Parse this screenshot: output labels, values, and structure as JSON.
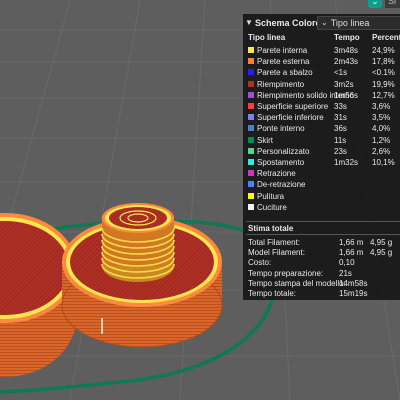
{
  "panel": {
    "title": "Schema Colore",
    "view_select": "Tipo linea",
    "columns": {
      "type": "Tipo linea",
      "time": "Tempo",
      "percent": "Percentuale"
    },
    "feature_rows": [
      {
        "name": "Parete interna",
        "time": "3m48s",
        "percent": "24,9%",
        "color": "#ffe64d"
      },
      {
        "name": "Parete esterna",
        "time": "2m43s",
        "percent": "17,8%",
        "color": "#ff7d38"
      },
      {
        "name": "Parete a sbalzo",
        "time": "<1s",
        "percent": "<0.1%",
        "color": "#1f1fff"
      },
      {
        "name": "Riempimento",
        "time": "3m2s",
        "percent": "19,9%",
        "color": "#b03029"
      },
      {
        "name": "Riempimento solido interno",
        "time": "1m56s",
        "percent": "12,7%",
        "color": "#9654cc"
      },
      {
        "name": "Superficie superiore",
        "time": "33s",
        "percent": "3,6%",
        "color": "#f04040"
      },
      {
        "name": "Superficie inferiore",
        "time": "31s",
        "percent": "3,5%",
        "color": "#7d7dff"
      },
      {
        "name": "Ponte interno",
        "time": "36s",
        "percent": "4,0%",
        "color": "#4d80ba"
      },
      {
        "name": "Skirt",
        "time": "11s",
        "percent": "1,2%",
        "color": "#00875c"
      },
      {
        "name": "Personalizzato",
        "time": "23s",
        "percent": "2,6%",
        "color": "#5ed195"
      },
      {
        "name": "Spostamento",
        "time": "1m32s",
        "percent": "10,1%",
        "color": "#38e8e0"
      },
      {
        "name": "Retrazione",
        "time": "",
        "percent": "",
        "color": "#cc33cc"
      },
      {
        "name": "De-retrazione",
        "time": "",
        "percent": "",
        "color": "#4d80ff"
      },
      {
        "name": "Pulitura",
        "time": "",
        "percent": "",
        "color": "#ffff00"
      },
      {
        "name": "Cuciture",
        "time": "",
        "percent": "",
        "color": "#f2f2f2"
      }
    ],
    "stats_title": "Stima totale",
    "stats": [
      {
        "label": "Total Filament:",
        "v1": "1,66 m",
        "v2": "4,95 g"
      },
      {
        "label": "Model Filament:",
        "v1": "1,66 m",
        "v2": "4,95 g"
      },
      {
        "label": "Costo:",
        "v1": "0,10",
        "v2": ""
      },
      {
        "label": "Tempo preparazione:",
        "v1": "21s",
        "v2": ""
      },
      {
        "label": "Tempo stampa del modello:",
        "v1": "14m58s",
        "v2": ""
      },
      {
        "label": "Tempo totale:",
        "v1": "15m19s",
        "v2": ""
      }
    ]
  },
  "topbar": {
    "toggle_glyph": "⌄",
    "tab_label": "Sl"
  },
  "colors": {
    "background": "#5e5e5e",
    "grid": "#6b6b6b",
    "infill": "#b03029",
    "wall_outer": "#ff7d38",
    "wall_inner": "#ffe64d",
    "skirt": "#00875c"
  }
}
